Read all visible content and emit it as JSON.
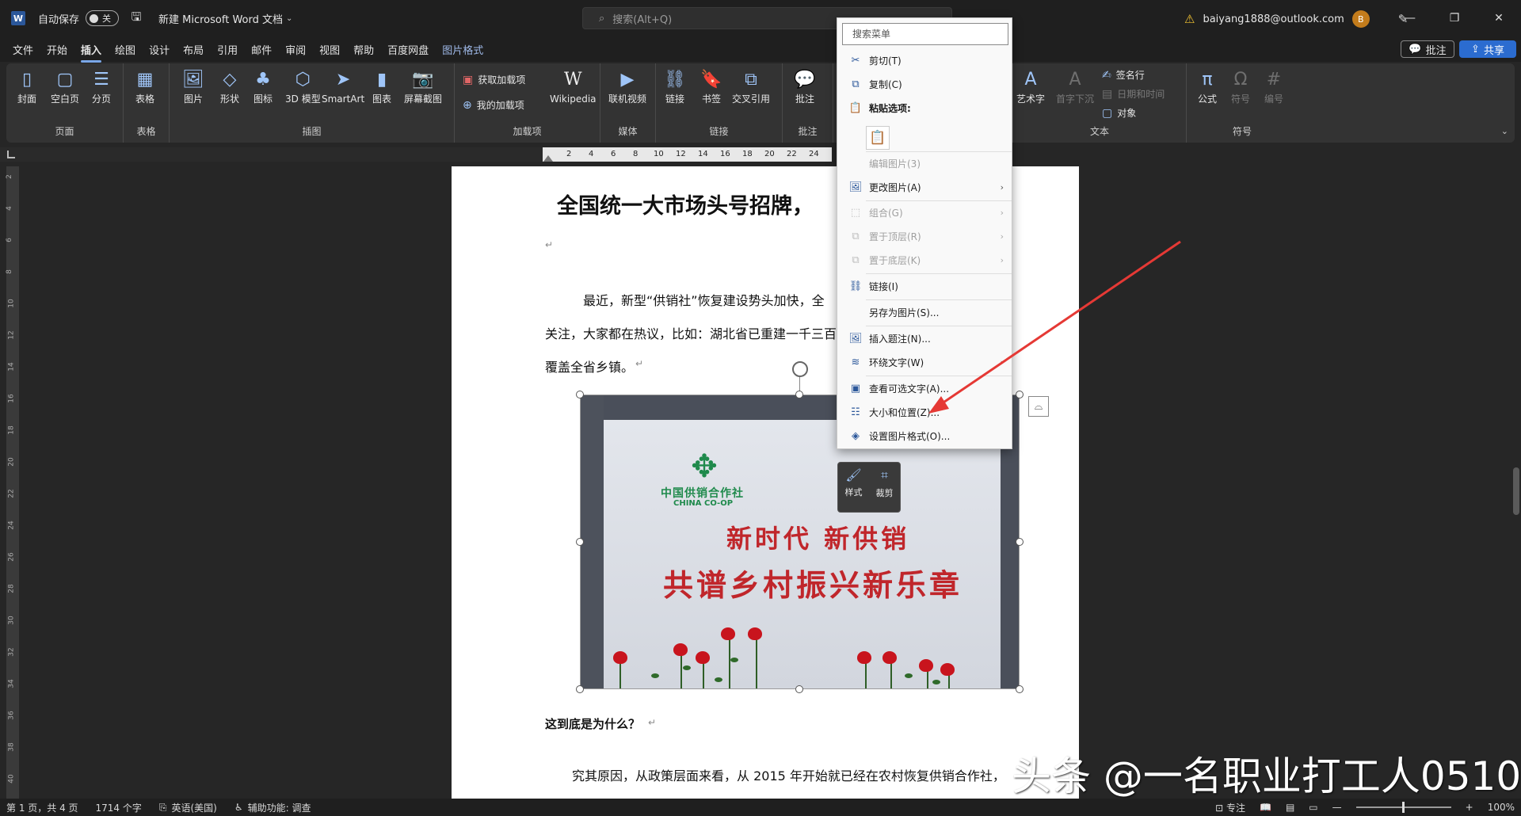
{
  "titlebar": {
    "app_icon": "W",
    "autosave_label": "自动保存",
    "autosave_state": "关",
    "save_icon": "save-icon",
    "doc_title": "新建 Microsoft Word 文档",
    "search_placeholder": "搜索(Alt+Q)",
    "account_email": "baiyang1888@outlook.com",
    "avatar_letter": "B",
    "window_buttons": [
      "—",
      "❐",
      "✕"
    ]
  },
  "menu": {
    "tabs": [
      "文件",
      "开始",
      "插入",
      "绘图",
      "设计",
      "布局",
      "引用",
      "邮件",
      "审阅",
      "视图",
      "帮助",
      "百度网盘",
      "图片格式"
    ],
    "active_tab": "插入",
    "comment_btn": "批注",
    "share_btn": "共享"
  },
  "ribbon": {
    "groups": {
      "pages": {
        "label": "页面",
        "items": [
          "封面",
          "空白页",
          "分页"
        ]
      },
      "tables": {
        "label": "表格",
        "items": [
          "表格"
        ]
      },
      "illustrations": {
        "label": "插图",
        "items": [
          "图片",
          "形状",
          "图标",
          "3D 模型",
          "SmartArt",
          "图表",
          "屏幕截图"
        ]
      },
      "addins": {
        "label": "加载项",
        "items": [
          "获取加载项",
          "我的加载项",
          "Wikipedia"
        ]
      },
      "media": {
        "label": "媒体",
        "items": [
          "联机视频"
        ]
      },
      "links": {
        "label": "链接",
        "items": [
          "链接",
          "书签",
          "交叉引用"
        ]
      },
      "comments": {
        "label": "批注",
        "items": [
          "批注"
        ]
      },
      "text": {
        "label": "文本",
        "items": [
          "艺术字",
          "首字下沉",
          "签名行",
          "日期和时间",
          "对象"
        ]
      },
      "symbols": {
        "label": "符号",
        "items": [
          "公式",
          "符号",
          "编号"
        ]
      }
    }
  },
  "ruler": {
    "ticks": [
      "2",
      "4",
      "6",
      "8",
      "10",
      "12",
      "14",
      "16",
      "18",
      "20",
      "22",
      "24"
    ],
    "vticks": [
      "2",
      "4",
      "6",
      "8",
      "10",
      "12",
      "14",
      "16",
      "18",
      "20",
      "22",
      "24",
      "26",
      "28",
      "30",
      "32",
      "34",
      "36",
      "38",
      "40"
    ]
  },
  "document": {
    "heading": "全国统一大市场头号招牌，",
    "para1_line1": "最近，新型“供销社”恢复建设势头加快，全",
    "para1_line2": "关注，大家都在热议，比如：湖北省已重建一千三百",
    "para1_line3": "覆盖全省乡镇。",
    "photo": {
      "org_name_cn": "中国供销合作社",
      "org_name_en": "CHINA CO-OP",
      "slogan1": "新时代 新供销",
      "slogan2": "共谱乡村振兴新乐章"
    },
    "subheading": "这到底是为什么？",
    "para2_line1": "究其原因，从政策层面来看，从 2015 年开始就已经在农村恢复供销合作社，",
    "para_mark": "↵"
  },
  "mini_toolbar": {
    "style_label": "样式",
    "crop_label": "裁剪"
  },
  "context_menu": {
    "search_placeholder": "搜索菜单",
    "items": {
      "cut": "剪切(T)",
      "copy": "复制(C)",
      "paste_options": "粘贴选项:",
      "edit_picture": "编辑图片(3)",
      "change_picture": "更改图片(A)",
      "group": "组合(G)",
      "bring_front": "置于顶层(R)",
      "send_back": "置于底层(K)",
      "link": "链接(I)",
      "save_as_picture": "另存为图片(S)...",
      "insert_caption": "插入题注(N)...",
      "wrap_text": "环绕文字(W)",
      "alt_text": "查看可选文字(A)...",
      "size_position": "大小和位置(Z)...",
      "format_picture": "设置图片格式(O)..."
    }
  },
  "annotation": {
    "arrow_color": "#e53935"
  },
  "watermark": "头条 @一名职业打工人0510",
  "statusbar": {
    "page_info": "第 1 页，共 4 页",
    "word_count": "1714 个字",
    "language": "英语(美国)",
    "accessibility": "辅助功能: 调查",
    "focus": "专注",
    "zoom": "100%"
  },
  "colors": {
    "accent": "#2b6cd0",
    "ribbon_bg": "#333333",
    "page_bg": "#ffffff",
    "slogan_red": "#c0262b",
    "coop_green": "#1f8a4c"
  }
}
